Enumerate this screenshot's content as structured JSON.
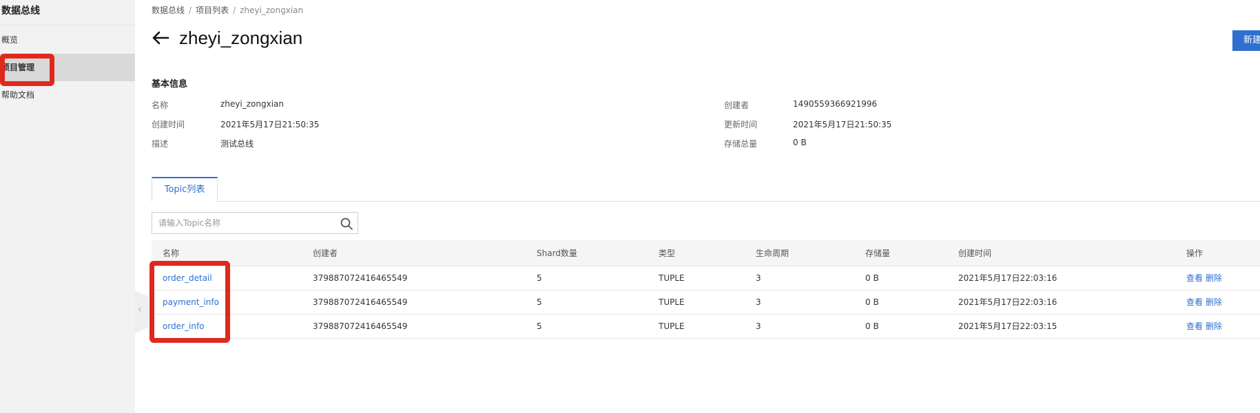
{
  "sidebar": {
    "title": "数据总线",
    "items": [
      {
        "label": "概览"
      },
      {
        "label": "项目管理"
      },
      {
        "label": "帮助文档"
      }
    ]
  },
  "breadcrumb": [
    "数据总线",
    "项目列表",
    "zheyi_zongxian"
  ],
  "breadcrumb_sep": "/",
  "page_title": "zheyi_zongxian",
  "new_button": "新建",
  "basic_info": {
    "title": "基本信息",
    "left": [
      {
        "label": "名称",
        "value": "zheyi_zongxian"
      },
      {
        "label": "创建时间",
        "value": "2021年5月17日21:50:35"
      },
      {
        "label": "描述",
        "value": "测试总线"
      }
    ],
    "right": [
      {
        "label": "创建者",
        "value": "1490559366921996"
      },
      {
        "label": "更新时间",
        "value": "2021年5月17日21:50:35"
      },
      {
        "label": "存储总量",
        "value": "0 B"
      }
    ]
  },
  "tabs": [
    {
      "label": "Topic列表"
    }
  ],
  "search": {
    "placeholder": "请输入Topic名称"
  },
  "table": {
    "columns": [
      "名称",
      "创建者",
      "Shard数量",
      "类型",
      "生命周期",
      "存储量",
      "创建时间",
      "操作"
    ],
    "rows": [
      {
        "name": "order_detail",
        "creator": "379887072416465549",
        "shards": "5",
        "type": "TUPLE",
        "lifecycle": "3",
        "storage": "0 B",
        "created": "2021年5月17日22:03:16",
        "view": "查看",
        "delete": "删除"
      },
      {
        "name": "payment_info",
        "creator": "379887072416465549",
        "shards": "5",
        "type": "TUPLE",
        "lifecycle": "3",
        "storage": "0 B",
        "created": "2021年5月17日22:03:16",
        "view": "查看",
        "delete": "删除"
      },
      {
        "name": "order_info",
        "creator": "379887072416465549",
        "shards": "5",
        "type": "TUPLE",
        "lifecycle": "3",
        "storage": "0 B",
        "created": "2021年5月17日22:03:15",
        "view": "查看",
        "delete": "删除"
      }
    ]
  },
  "colors": {
    "accent": "#2f6fd1",
    "highlight": "#e0291d"
  }
}
